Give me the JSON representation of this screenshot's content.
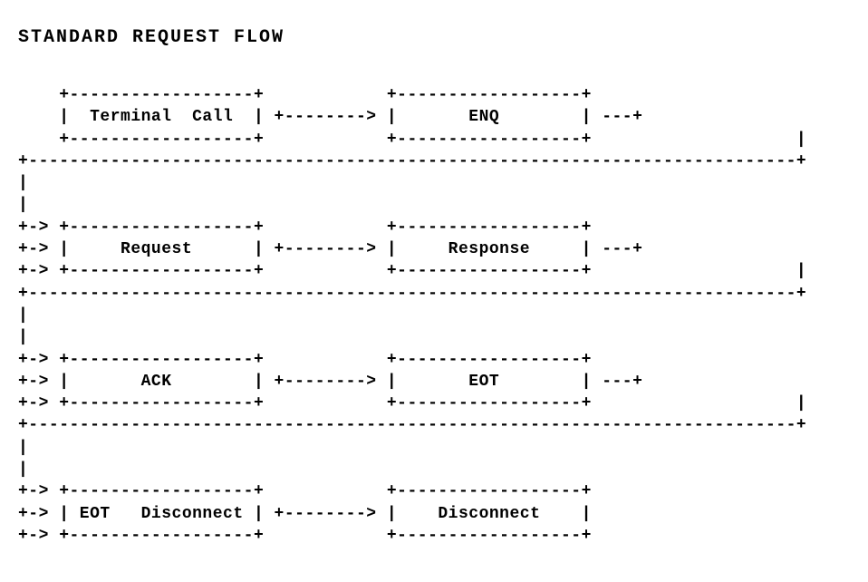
{
  "title": "STANDARD REQUEST FLOW",
  "flow": {
    "rows": [
      {
        "left": "Terminal  Call",
        "right": "ENQ"
      },
      {
        "left": "Request",
        "right": "Response"
      },
      {
        "left": "ACK",
        "right": "EOT"
      },
      {
        "left": "EOT   Disconnect",
        "right": "Disconnect"
      }
    ],
    "connectors": {
      "arrow_between_boxes": "+--------> ",
      "trailing_arrow": " ---+",
      "leading_arrow": "+-> ",
      "wrap_line": true
    }
  }
}
